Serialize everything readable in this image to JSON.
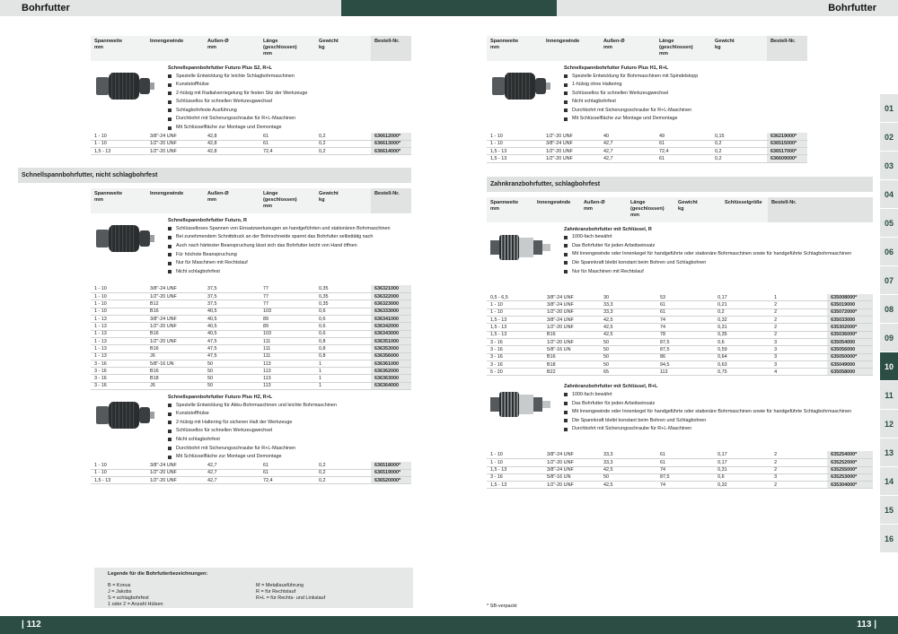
{
  "page": {
    "title_left": "Bohrfutter",
    "title_right": "Bohrfutter",
    "page_left": "| 112",
    "page_right": "113 |"
  },
  "tabs": [
    "01",
    "02",
    "03",
    "04",
    "05",
    "06",
    "07",
    "08",
    "09",
    "10",
    "11",
    "12",
    "13",
    "14",
    "15",
    "16"
  ],
  "active_tab": "10",
  "headers": {
    "h6": [
      "Spannweite\nmm",
      "Innengewinde",
      "Außen-Ø\nmm",
      "Länge\n(geschlossen)\nmm",
      "Gewicht\nkg",
      "Bestell-Nr."
    ],
    "h7": [
      "Spannweite\nmm",
      "Innengewinde",
      "Außen-Ø\nmm",
      "Länge\n(geschlossen)\nmm",
      "Gewicht\nkg",
      "Schlüsselgröße",
      "Bestell-Nr."
    ]
  },
  "left": {
    "p1": {
      "title": "Schnellspannbohrfutter Futuro Plus S2, R+L",
      "bullets": [
        "Spezielle Entwicklung für leichte Schlagbohrmaschinen",
        "Kunststoffhülse",
        "2-hülsig mit Radialverriegelung für festen Sitz der Werkzeuge",
        "Schlüssellos für schnellen Werkzeugwechsel",
        "Schlagbohrfeste Ausführung",
        "Durchbohrt mit Sicherungsschraube für R+L-Maschinen",
        "Mit Schlüsselfläche zur Montage und Demontage"
      ],
      "rows": [
        [
          "1 - 10",
          "3/8\"-24 UNF",
          "42,8",
          "61",
          "0,2",
          "636612000*"
        ],
        [
          "1 - 10",
          "1/2\"-20 UNF",
          "42,8",
          "61",
          "0,2",
          "636613000*"
        ],
        [
          "1,5 - 13",
          "1/2\"-20 UNF",
          "42,8",
          "72,4",
          "0,2",
          "636614000*"
        ]
      ]
    },
    "section2": "Schnellspannbohrfutter, nicht schlagbohrfest",
    "p2": {
      "title": "Schnellspannbohrfutter Futuro, R",
      "bullets": [
        "Schlüsselloses Spannen von Einsatzwerkzeugen an handgeführten und stationären Bohrmaschinen",
        "Bei zunehmendem Schnittdruck an der Bohrschneide spannt das Bohrfutter selbsttätig nach",
        "Auch nach härtester Beanspruchung lässt sich das Bohrfutter leicht von Hand öffnen",
        "Für höchste Beanspruchung",
        "Nur für Maschinen mit Rechtslauf",
        "Nicht schlagbohrfest"
      ],
      "rows": [
        [
          "1 - 10",
          "3/8\"-24 UNF",
          "37,5",
          "77",
          "0,35",
          "636321000"
        ],
        [
          "1 - 10",
          "1/2\"-20 UNF",
          "37,5",
          "77",
          "0,35",
          "636322000"
        ],
        [
          "1 - 10",
          "B12",
          "37,5",
          "77",
          "0,35",
          "636323000"
        ],
        [
          "1 - 10",
          "B16",
          "40,5",
          "103",
          "0,6",
          "636333000"
        ],
        [
          "1 - 13",
          "3/8\"-24 UNF",
          "40,5",
          "89",
          "0,6",
          "636341000"
        ],
        [
          "1 - 13",
          "1/2\"-20 UNF",
          "40,5",
          "89",
          "0,6",
          "636342000"
        ],
        [
          "1 - 13",
          "B16",
          "40,5",
          "103",
          "0,6",
          "636343000"
        ],
        [
          "1 - 13",
          "1/2\"-20 UNF",
          "47,5",
          "111",
          "0,8",
          "636351000"
        ],
        [
          "1 - 13",
          "B16",
          "47,5",
          "111",
          "0,8",
          "636353000"
        ],
        [
          "1 - 13",
          "J6",
          "47,5",
          "111",
          "0,8",
          "636356000"
        ],
        [
          "3 - 16",
          "5/8\"-16 UN",
          "50",
          "113",
          "1",
          "636361000"
        ],
        [
          "3 - 16",
          "B16",
          "50",
          "113",
          "1",
          "636362000"
        ],
        [
          "3 - 16",
          "B18",
          "50",
          "113",
          "1",
          "636363000"
        ],
        [
          "3 - 16",
          "J6",
          "50",
          "113",
          "1",
          "636364000"
        ]
      ]
    },
    "p3": {
      "title": "Schnellspannbohrfutter Futuro Plus H2, R+L",
      "bullets": [
        "Spezielle Entwicklung für Akku-Bohrmaschinen und leichte Bohrmaschinen",
        "Kunststoffhülse",
        "2-hülsig mit Haltering für sicheren Halt der Werkzeuge",
        "Schlüssellos für schnellen Werkzeugwechsel",
        "Nicht schlagbohrfest",
        "Durchbohrt mit Sicherungsschraube für R+L-Maschinen",
        "Mit Schlüsselfläche zur Montage und Demontage"
      ],
      "rows": [
        [
          "1 - 10",
          "3/8\"-24 UNF",
          "42,7",
          "61",
          "0,2",
          "636518000*"
        ],
        [
          "1 - 10",
          "1/2\"-20 UNF",
          "42,7",
          "61",
          "0,2",
          "636519000*"
        ],
        [
          "1,5 - 13",
          "1/2\"-20 UNF",
          "42,7",
          "72,4",
          "0,2",
          "636520000*"
        ]
      ]
    },
    "legend": {
      "title": "Legende für die Bohrfutterbezeichnungen:",
      "col1": [
        "B = Konus",
        "J = Jakobs",
        "S = schlagbohrfest",
        "1 oder 2 = Anzahl Hülsen"
      ],
      "col2": [
        "M = Metallausführung",
        "R = für Rechtslauf",
        "R+L = für Rechts- und Linkslauf"
      ]
    }
  },
  "right": {
    "p1": {
      "title": "Schnellspannbohrfutter Futuro Plus H1, R+L",
      "bullets": [
        "Spezielle Entwicklung für Bohrmaschinen mit Spindelstopp",
        "1-hülsig ohne Haltering",
        "Schlüssellos für schnellen Werkzeugwechsel",
        "Nicht schlagbohrfest",
        "Durchbohrt mit Sicherungsschraube für R+L-Maschinen",
        "Mit Schlüsselfläche zur Montage und Demontage"
      ],
      "rows": [
        [
          "1 - 10",
          "1/2\"-20 UNF",
          "40",
          "49",
          "0,15",
          "636219000*"
        ],
        [
          "1 - 10",
          "3/8\"-24 UNF",
          "42,7",
          "61",
          "0,2",
          "636515000*"
        ],
        [
          "1,5 - 13",
          "1/2\"-20 UNF",
          "42,7",
          "72,4",
          "0,2",
          "636517000*"
        ],
        [
          "1,5 - 13",
          "1/2\"-20 UNF",
          "42,7",
          "61",
          "0,2",
          "636609000*"
        ]
      ]
    },
    "section2": "Zahnkranzbohrfutter, schlagbohrfest",
    "p2": {
      "title": "Zahnkranzbohrfutter mit Schlüssel, R",
      "bullets": [
        "1000-fach bewährt",
        "Das Bohrfutter für jeden Arbeitseinsatz",
        "Mit Innengewinde oder Innenkegel für handgeführte oder stationäre Bohrmaschinen sowie für handgeführte Schlagbohrmaschinen",
        "Die Spannkraft bleibt konstant beim Bohren und Schlagbohren",
        "Nur für Maschinen mit Rechtslauf"
      ],
      "rows": [
        [
          "0,5 - 6,5",
          "3/8\"-24 UNF",
          "30",
          "53",
          "0,17",
          "1",
          "635008000*"
        ],
        [
          "1 - 10",
          "3/8\"-24 UNF",
          "33,3",
          "61",
          "0,21",
          "2",
          "635019000"
        ],
        [
          "1 - 10",
          "1/2\"-20 UNF",
          "33,3",
          "61",
          "0,2",
          "2",
          "635072000*"
        ],
        [
          "1,5 - 13",
          "3/8\"-24 UNF",
          "42,5",
          "74",
          "0,32",
          "2",
          "635033000"
        ],
        [
          "1,5 - 13",
          "1/2\"-20 UNF",
          "42,5",
          "74",
          "0,31",
          "2",
          "635302000*"
        ],
        [
          "1,5 - 13",
          "B16",
          "42,5",
          "78",
          "0,35",
          "2",
          "635036000*"
        ],
        [
          "3 - 16",
          "1/2\"-20 UNF",
          "50",
          "87,5",
          "0,6",
          "3",
          "635054000"
        ],
        [
          "3 - 16",
          "5/8\"-16 UN",
          "50",
          "87,5",
          "0,59",
          "3",
          "635056000"
        ],
        [
          "3 - 16",
          "B16",
          "50",
          "86",
          "0,64",
          "3",
          "635050000*"
        ],
        [
          "3 - 16",
          "B18",
          "50",
          "94,5",
          "0,63",
          "3",
          "635049000"
        ],
        [
          "5 - 20",
          "B22",
          "65",
          "113",
          "0,75",
          "4",
          "635058000"
        ]
      ]
    },
    "p3": {
      "title": "Zahnkranzbohrfutter mit Schlüssel, R+L",
      "bullets": [
        "1000-fach bewährt",
        "Das Bohrfutter für jeden Arbeitseinsatz",
        "Mit Innengewinde oder Innenkegel für handgeführte oder stationäre Bohrmaschinen sowie für handgeführte Schlagbohrmaschinen",
        "Die Spannkraft bleibt konstant beim Bohren und Schlagbohren",
        "Durchbohrt mit Sicherungsschraube für R+L-Maschinen"
      ],
      "rows": [
        [
          "1 - 10",
          "3/8\"-24 UNF",
          "33,3",
          "61",
          "0,17",
          "2",
          "635254000*"
        ],
        [
          "1 - 10",
          "1/2\"-20 UNF",
          "33,3",
          "61",
          "0,17",
          "2",
          "635252000*"
        ],
        [
          "1,5 - 13",
          "3/8\"-24 UNF",
          "42,5",
          "74",
          "0,31",
          "2",
          "635255000*"
        ],
        [
          "3 - 16",
          "5/8\"-16 UN",
          "50",
          "87,5",
          "0,6",
          "3",
          "635253000*"
        ],
        [
          "1,5 - 13",
          "1/2\"-20 UNF",
          "42,5",
          "74",
          "0,32",
          "2",
          "635304000*"
        ]
      ]
    },
    "footnote": "* SB-verpackt"
  }
}
